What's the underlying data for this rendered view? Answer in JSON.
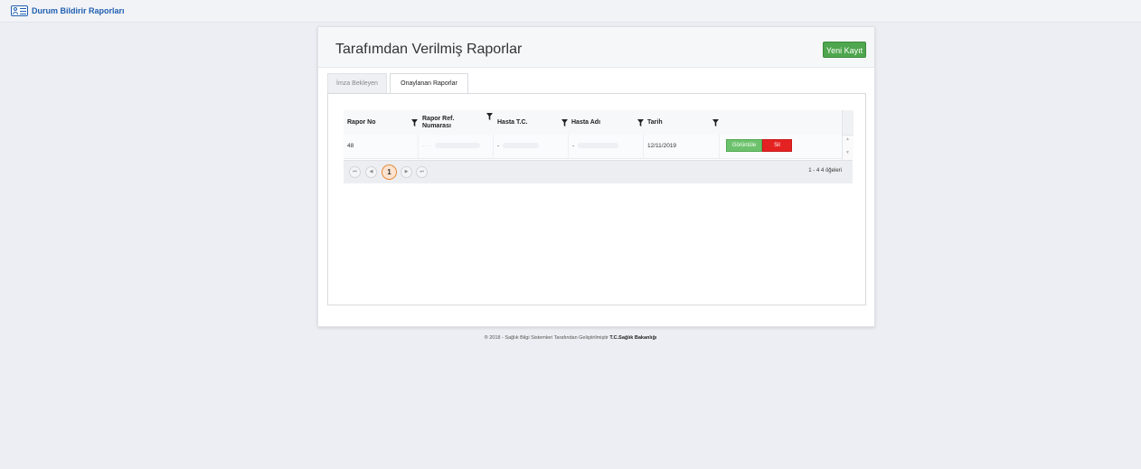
{
  "topbar": {
    "brand_label": "Durum Bildirir Raporları",
    "brand_icon": "id-card-icon"
  },
  "panel": {
    "title": "Tarafımdan Verilmiş Raporlar",
    "new_button": "Yeni Kayıt"
  },
  "tabs": [
    {
      "label": "İmza Bekleyen",
      "active": false
    },
    {
      "label": "Onaylanan Raporlar",
      "active": true
    }
  ],
  "grid": {
    "columns": [
      "Rapor No",
      "Rapor Ref. Numarası",
      "Hasta T.C.",
      "Hasta Adı",
      "Tarih"
    ],
    "rows": [
      {
        "rapor_no": "48",
        "rapor_ref": "· · ·",
        "hasta_tc": "-",
        "hasta_adi": "-",
        "tarih": "12/11/2019",
        "view_label": "Görüntüle",
        "delete_label": "Sil"
      }
    ],
    "pager": {
      "current_page": "1",
      "info": "1 - 4 4 öğeleri"
    }
  },
  "footer": {
    "text": "® 2018 - Sağlık Bilgi Sistemleri Tarafından Geliştirilmiştir",
    "org": "T.C.Sağlık Bakanlığı"
  },
  "colors": {
    "brand": "#1f5fb0",
    "green_button": "#4ea64e",
    "delete_button": "#e52222",
    "current_page": "#e48a3e"
  }
}
